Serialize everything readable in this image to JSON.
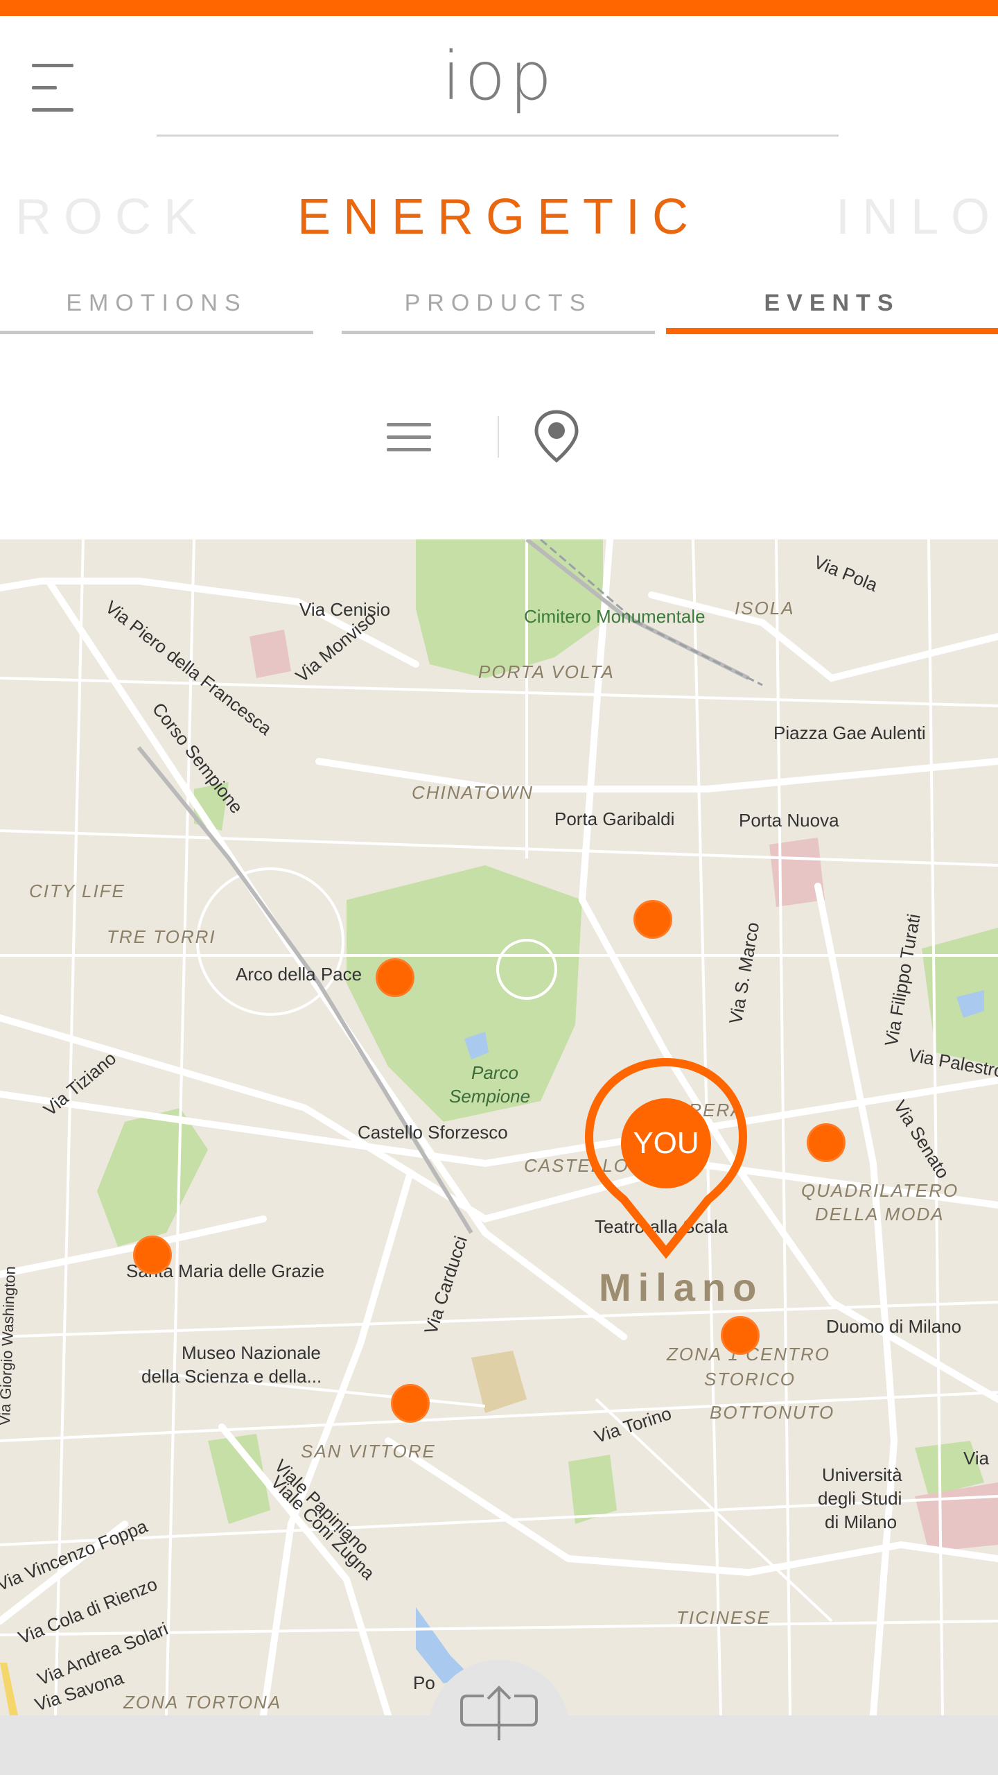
{
  "header": {
    "logo_text": "iop",
    "menu_icon": "menu-icon"
  },
  "moods": {
    "previous": "ROCK",
    "current": "ENERGETIC",
    "next": "INLO"
  },
  "tabs": [
    {
      "label": "EMOTIONS",
      "active": false
    },
    {
      "label": "PRODUCTS",
      "active": false
    },
    {
      "label": "EVENTS",
      "active": true
    }
  ],
  "view_switch": {
    "list_icon": "list-icon",
    "map_icon": "map-pin-icon",
    "selected": "map"
  },
  "map": {
    "city": "Milano",
    "streets": [
      "Via Pola",
      "Via Cenisio",
      "Via Piero della Francesca",
      "Via Monviso",
      "Corso Sempione",
      "Via S. Marco",
      "Via Filippo Turati",
      "Via Palestro",
      "Via Senato",
      "Via Tiziano",
      "Via Carducci",
      "Via Torino",
      "Viale Papiniano",
      "Viale Coni Zugna",
      "Via Giorgio Washington",
      "Via Vincenzo Foppa",
      "Via Cola di Rienzo",
      "Via Andrea Solari",
      "Via Savona",
      "Via"
    ],
    "districts": [
      "ISOLA",
      "PORTA VOLTA",
      "CHINATOWN",
      "CITY LIFE",
      "TRE TORRI",
      "CASTELLO",
      "BRERA",
      "QUADRILATERO",
      "DELLA MODA",
      "ZONA 1 CENTRO",
      "STORICO",
      "BOTTONUTO",
      "SAN VITTORE",
      "TICINESE",
      "ZONA TORTONA"
    ],
    "places": [
      "Cimitero Monumentale",
      "Piazza Gae Aulenti",
      "Porta Garibaldi",
      "Porta Nuova",
      "Arco della Pace",
      "Parco",
      "Sempione",
      "Castello Sforzesco",
      "Teatro alla Scala",
      "Santa Maria delle Grazie",
      "Museo Nazionale",
      "della Scienza e della...",
      "Duomo di Milano",
      "Università",
      "degli Studi",
      "di Milano",
      "Po"
    ],
    "user_marker_label": "YOU",
    "event_markers": 6
  },
  "footer": {
    "upload_icon": "upload-icon"
  },
  "colors": {
    "accent": "#ff6600",
    "map_land": "#ece8dd",
    "park": "#c6dfa6",
    "road": "#ffffff"
  }
}
